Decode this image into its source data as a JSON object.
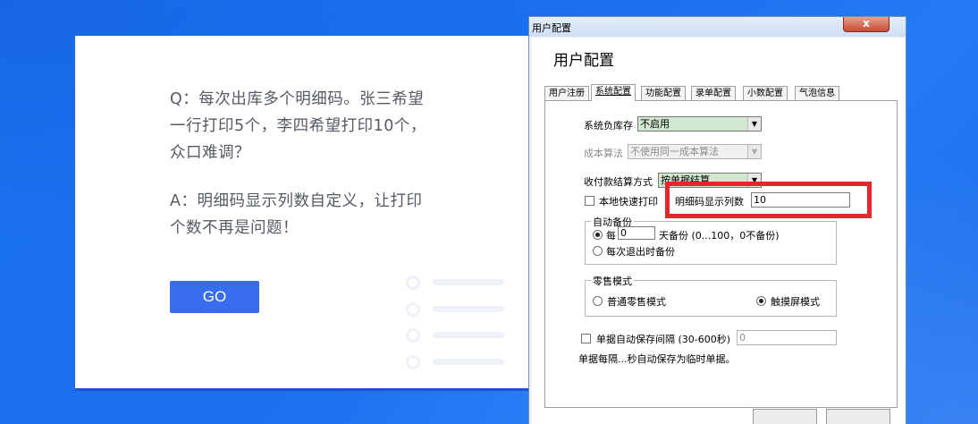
{
  "promo": {
    "question": "Q：每次出库多个明细码。张三希望一行打印5个，李四希望打印10个，众口难调？",
    "answer": "A：明细码显示列数自定义，让打印个数不再是问题！",
    "go_label": "GO"
  },
  "dialog": {
    "window_title": "用户配置",
    "close_glyph": "x",
    "heading": "用户配置",
    "tabs": [
      {
        "label": "用户注册"
      },
      {
        "label": "系统配置"
      },
      {
        "label": "功能配置"
      },
      {
        "label": "录单配置"
      },
      {
        "label": "小数配置"
      },
      {
        "label": "气泡信息"
      }
    ],
    "active_tab": "系统配置",
    "negative_stock": {
      "label": "系统负库存",
      "value": "不启用"
    },
    "cost_method": {
      "label": "成本算法",
      "value": "不使用同一成本算法"
    },
    "payment_method": {
      "label": "收付款结算方式",
      "value": "按单据结算"
    },
    "local_quick_print": {
      "label": "本地快速打印",
      "checked": false
    },
    "detail_code_columns": {
      "label": "明细码显示列数",
      "value": "10"
    },
    "auto_backup": {
      "title": "自动备份",
      "every_label": "每",
      "days_value": "0",
      "days_suffix": "天备份 (0...100，0不备份)",
      "on_exit_label": "每次退出时备份",
      "selected": "every"
    },
    "retail_mode": {
      "title": "零售模式",
      "normal_label": "普通零售模式",
      "touch_label": "触摸屏模式",
      "selected": "touch"
    },
    "autosave": {
      "label": "单据自动保存间隔 (30-600秒)",
      "value": "0",
      "checked": false
    },
    "autosave_note": "单据每隔...秒自动保存为临时单据。"
  },
  "colors": {
    "background_blue": "#1a73ee",
    "go_button": "#3a6cf0",
    "highlight_red": "#e8242c",
    "combo_green": "#cfe8cf"
  }
}
